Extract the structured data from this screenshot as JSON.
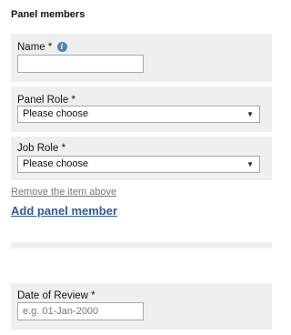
{
  "section": {
    "title": "Panel members"
  },
  "name_field": {
    "label": "Name *",
    "info_icon": "info-icon",
    "value": ""
  },
  "panel_role": {
    "label": "Panel Role *",
    "selected": "Please choose"
  },
  "job_role": {
    "label": "Job Role *",
    "selected": "Please choose"
  },
  "actions": {
    "remove_label": "Remove the item above",
    "add_label": "Add panel member"
  },
  "review_date": {
    "label": "Date of Review *",
    "placeholder": "e.g. 01-Jan-2000"
  },
  "colors": {
    "panel_bg": "#efefef",
    "link_blue": "#2c5aa0",
    "info_blue": "#4a7fc7"
  }
}
